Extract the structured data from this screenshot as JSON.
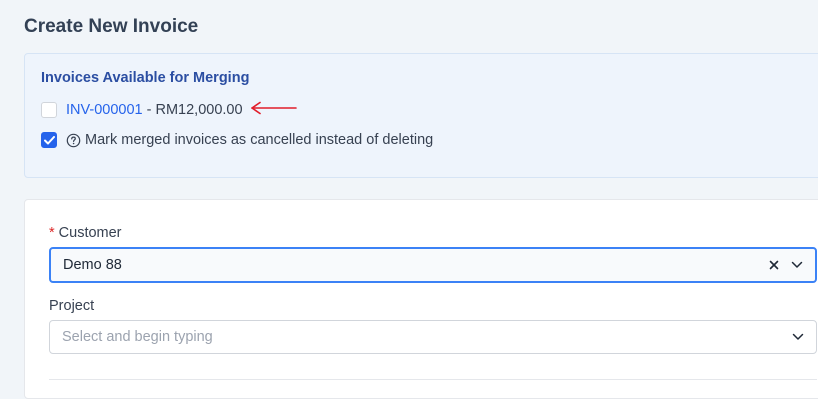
{
  "page": {
    "title": "Create New Invoice"
  },
  "merge": {
    "heading": "Invoices Available for Merging",
    "invoices": [
      {
        "number": "INV-000001",
        "separator": " - ",
        "amount": "RM12,000.00",
        "checked": false
      }
    ],
    "mark_cancelled_label": "Mark merged invoices as cancelled instead of deleting",
    "mark_cancelled_checked": true
  },
  "form": {
    "customer": {
      "label": "Customer",
      "required_mark": "*",
      "value": "Demo 88"
    },
    "project": {
      "label": "Project",
      "placeholder": "Select and begin typing"
    }
  },
  "colors": {
    "accent": "#2563eb",
    "heading_blue": "#2b4ea2",
    "annotation_arrow": "#e11d2a",
    "required": "#dc2626"
  },
  "icons": {
    "help": "question-circle-icon",
    "clear": "close-icon",
    "dropdown": "chevron-down-icon",
    "annotation": "arrow-left-icon"
  }
}
